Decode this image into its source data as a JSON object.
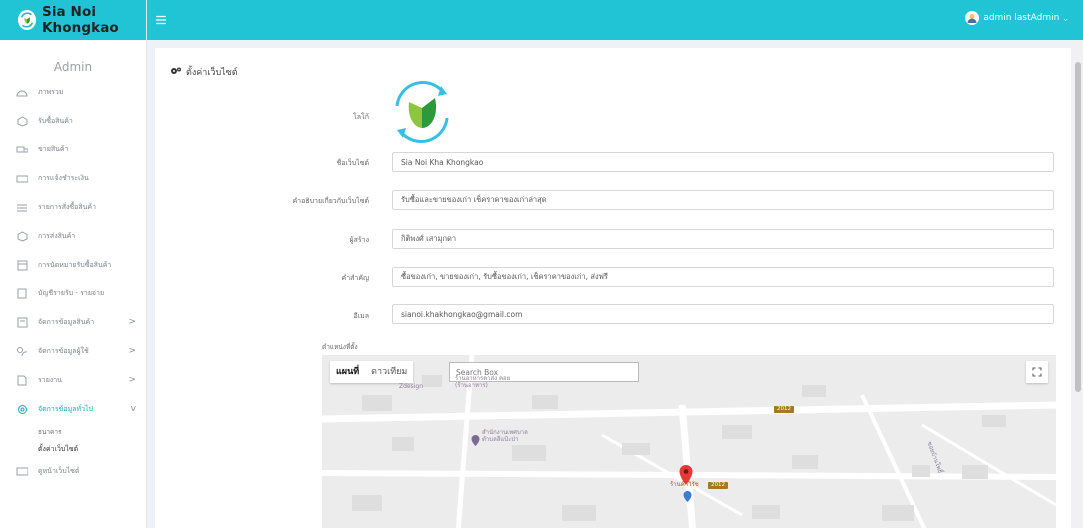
{
  "brand": {
    "name": "Sia Noi Khongkao",
    "icon": "leaf-recycle-logo"
  },
  "topbar": {
    "menu_icon": "hamburger-icon",
    "user_name": "admin lastAdmin"
  },
  "sidebar": {
    "role": "Admin",
    "items": [
      {
        "label": "ภาพรวม",
        "icon": "dashboard-icon"
      },
      {
        "label": "รับซื้อสินค้า",
        "icon": "box-icon"
      },
      {
        "label": "ขายสินค้า",
        "icon": "truck-icon"
      },
      {
        "label": "การแจ้งชำระเงิน",
        "icon": "payment-icon"
      },
      {
        "label": "รายการสั่งซื้อสินค้า",
        "icon": "list-icon"
      },
      {
        "label": "การส่งสินค้า",
        "icon": "package-icon"
      },
      {
        "label": "การนัดหมายรับซื้อสินค้า",
        "icon": "calendar-icon"
      },
      {
        "label": "บัญชีรายรับ - รายจ่าย",
        "icon": "ledger-icon"
      },
      {
        "label": "จัดการข้อมูลสินค้า",
        "icon": "product-icon",
        "chevron": ">"
      },
      {
        "label": "จัดการข้อมูลผู้ใช้",
        "icon": "users-icon",
        "chevron": ">"
      },
      {
        "label": "รายงาน",
        "icon": "report-icon",
        "chevron": ">"
      },
      {
        "label": "จัดการข้อมูลทั่วไป",
        "icon": "settings-icon",
        "chevron": "v"
      }
    ],
    "subitems": [
      "ธนาคาร",
      "ตั้งค่าเว็บไซต์"
    ],
    "last_item": {
      "label": "ดูหน้าเว็บไซต์",
      "icon": "monitor-icon"
    }
  },
  "page": {
    "title": "ตั้งค่าเว็บไซต์",
    "labels": {
      "logo": "โลโก้",
      "site_name": "ชื่อเว็บไซต์",
      "description": "คำอธิบายเกี่ยวกับเว็บไซต์",
      "creator": "ผู้สร้าง",
      "keywords": "คำสำคัญ",
      "email": "อีเมล",
      "location": "ตำแหน่งที่ตั้ง"
    },
    "values": {
      "site_name": "Sia Noi Kha Khongkao",
      "description": "รับซื้อและขายของเก่า เช็คราคาของเก่าล่าสุด",
      "creator": "กิติพงศ์ เสามุกดา",
      "keywords": "ซื้อของเก่า, ขายของเก่า, รับซื้อของเก่า, เช็คราคาของเก่า, ส่งฟรี",
      "email": "sianoi.khakhongkao@gmail.com"
    }
  },
  "map": {
    "tab_map": "แผนที่",
    "tab_satellite": "ดาวเทียม",
    "search_placeholder": "Search Box",
    "place_zdesign": "Zdesign",
    "place_shop": "ร้านอาหารตาส่ง คอย (ร้านอาหาร)",
    "place_office": "สำนักงานเทศบาล ตำบลสีแป้ะป่า",
    "place_marker": "ร้านค้าวิรัช",
    "road_1": "2012",
    "road_2": "2012",
    "street": "ซอยบ้านโพธิ์"
  },
  "colors": {
    "topbar": "#20c4d4",
    "accent": "#1ea8b6",
    "marker": "#e53935"
  }
}
